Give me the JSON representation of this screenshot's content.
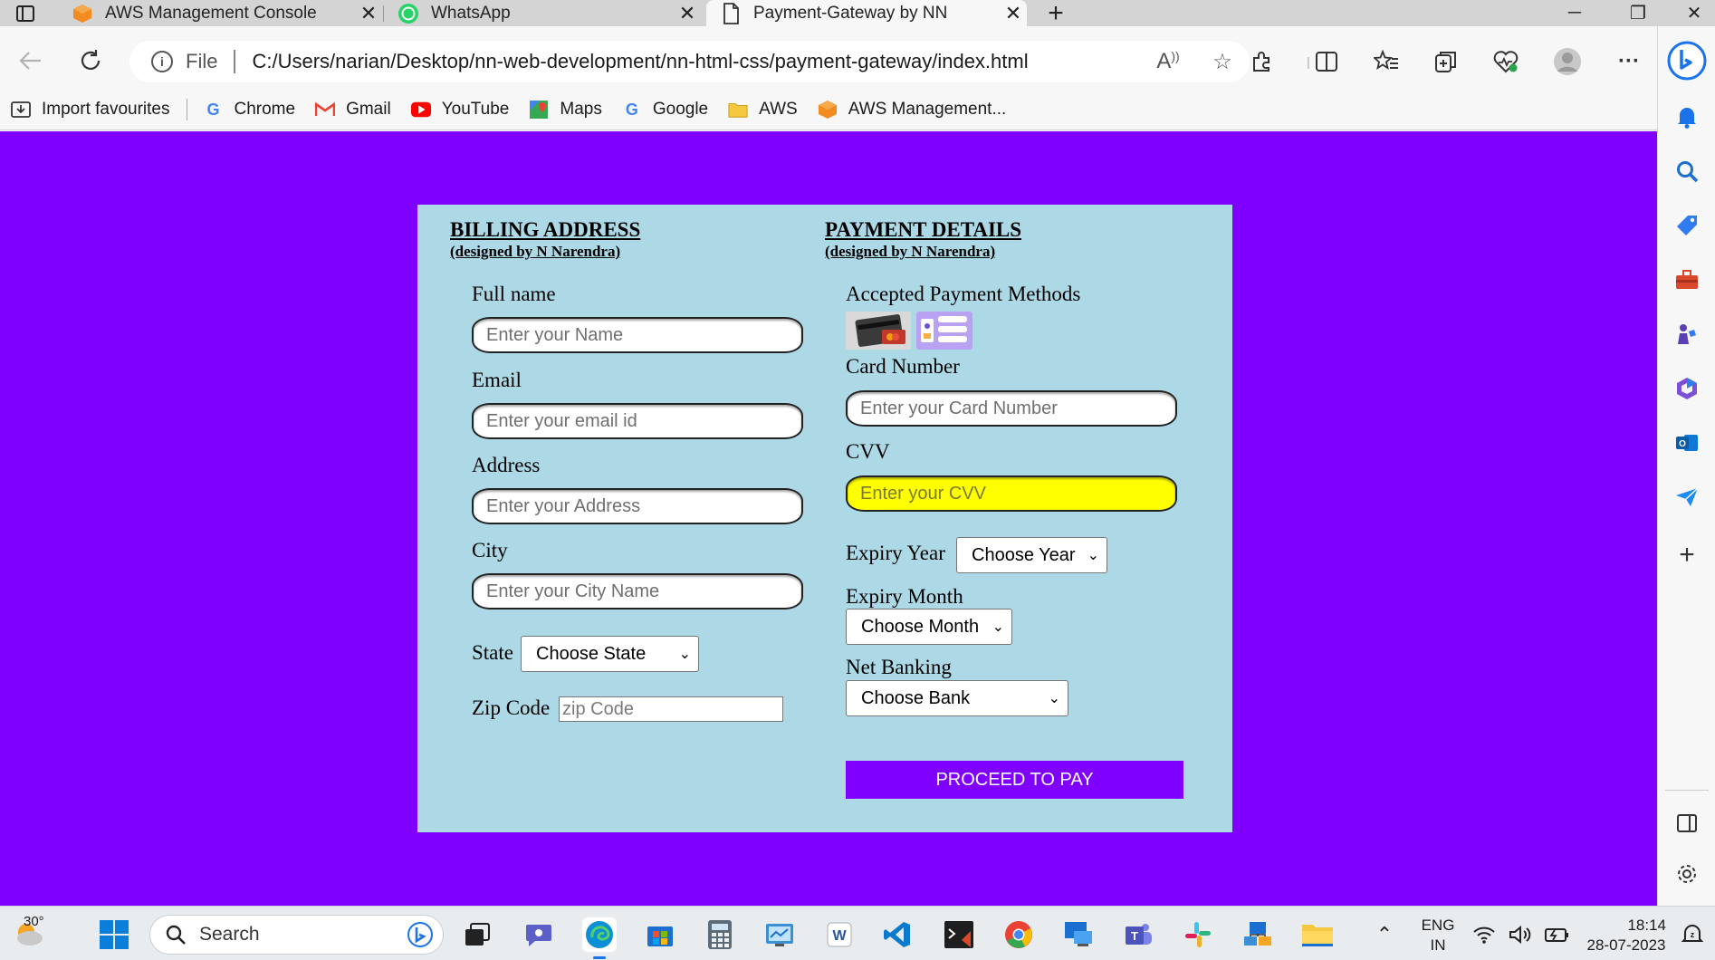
{
  "browser": {
    "tabs": [
      {
        "title": "AWS Management Console",
        "icon": "aws-icon",
        "active": false
      },
      {
        "title": "WhatsApp",
        "icon": "whatsapp-icon",
        "active": false
      },
      {
        "title": "Payment-Gateway by NN",
        "icon": "document-icon",
        "active": true
      }
    ],
    "new_tab_label": "+",
    "address": {
      "scheme_label": "File",
      "url": "C:/Users/narian/Desktop/nn-web-development/nn-html-css/payment-gateway/index.html"
    },
    "favourites": [
      {
        "label": "Import favourites",
        "icon": "import-icon"
      },
      {
        "label": "Chrome",
        "icon": "google-icon"
      },
      {
        "label": "Gmail",
        "icon": "gmail-icon"
      },
      {
        "label": "YouTube",
        "icon": "youtube-icon"
      },
      {
        "label": "Maps",
        "icon": "maps-icon"
      },
      {
        "label": "Google",
        "icon": "google-icon"
      },
      {
        "label": "AWS",
        "icon": "folder-icon"
      },
      {
        "label": "AWS Management...",
        "icon": "aws-icon"
      }
    ]
  },
  "page": {
    "background": "#8000ff",
    "card_background": "#add8e6",
    "billing": {
      "heading": "BILLING ADDRESS",
      "subheading": "(designed by N Narendra)",
      "full_name_label": "Full name",
      "full_name_placeholder": "Enter your Name",
      "email_label": "Email",
      "email_placeholder": "Enter your email id",
      "address_label": "Address",
      "address_placeholder": "Enter your Address",
      "city_label": "City",
      "city_placeholder": "Enter your City Name",
      "state_label": "State",
      "state_selected": "Choose State",
      "zip_label": "Zip Code",
      "zip_placeholder": "zip Code"
    },
    "payment": {
      "heading": "PAYMENT DETAILS",
      "subheading": "(designed by N Narendra)",
      "methods_label": "Accepted Payment Methods",
      "card_number_label": "Card Number",
      "card_number_placeholder": "Enter your Card Number",
      "cvv_label": "CVV",
      "cvv_placeholder": "Enter your CVV",
      "cvv_highlight": "#ffff00",
      "expiry_year_label": "Expiry Year",
      "expiry_year_selected": "Choose Year",
      "expiry_month_label": "Expiry Month",
      "expiry_month_selected": "Choose Month",
      "net_banking_label": "Net Banking",
      "net_banking_selected": "Choose Bank",
      "submit_label": "PROCEED TO PAY",
      "submit_color": "#8000ff"
    }
  },
  "taskbar": {
    "weather_temp": "30°",
    "search_label": "Search",
    "language_line1": "ENG",
    "language_line2": "IN",
    "time": "18:14",
    "date": "28-07-2023"
  }
}
